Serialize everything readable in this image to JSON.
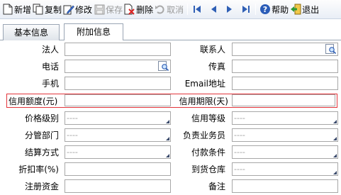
{
  "toolbar": {
    "new_label": "新增",
    "copy_label": "复制",
    "edit_label": "修改",
    "save_label": "保存",
    "delete_label": "删除",
    "cancel_label": "取消",
    "help_label": "帮助",
    "exit_label": "退出"
  },
  "tabs": {
    "basic": "基本信息",
    "extra": "附加信息"
  },
  "form": {
    "legal_person": {
      "label": "法人",
      "value": ""
    },
    "contact": {
      "label": "联系人",
      "value": ""
    },
    "phone": {
      "label": "电话",
      "value": ""
    },
    "fax": {
      "label": "传真",
      "value": ""
    },
    "mobile": {
      "label": "手机",
      "value": ""
    },
    "email": {
      "label": "Email地址",
      "value": ""
    },
    "credit_limit": {
      "label": "信用额度(元)",
      "value": ""
    },
    "credit_period": {
      "label": "信用期限(天)",
      "value": ""
    },
    "price_level": {
      "label": "价格级别",
      "value": "----"
    },
    "credit_grade": {
      "label": "信用等级",
      "value": "----"
    },
    "dept": {
      "label": "分管部门",
      "value": "----"
    },
    "salesman": {
      "label": "负责业务员",
      "value": "----"
    },
    "settlement": {
      "label": "结算方式",
      "value": "----"
    },
    "payment_terms": {
      "label": "付款条件",
      "value": "----"
    },
    "discount": {
      "label": "折扣率(%)",
      "value": ""
    },
    "warehouse": {
      "label": "到货仓库",
      "value": "----"
    },
    "capital": {
      "label": "注册资金",
      "value": ""
    },
    "remark": {
      "label": "备注",
      "value": ""
    }
  },
  "colors": {
    "highlight_border": "#e2343a",
    "nav_arrow": "#2f5fb5"
  },
  "icons": [
    "new-doc-icon",
    "copy-icon",
    "edit-icon",
    "save-icon",
    "delete-icon",
    "undo-icon",
    "first-icon",
    "prev-icon",
    "next-icon",
    "last-icon",
    "help-icon",
    "exit-icon",
    "lookup-icon"
  ]
}
